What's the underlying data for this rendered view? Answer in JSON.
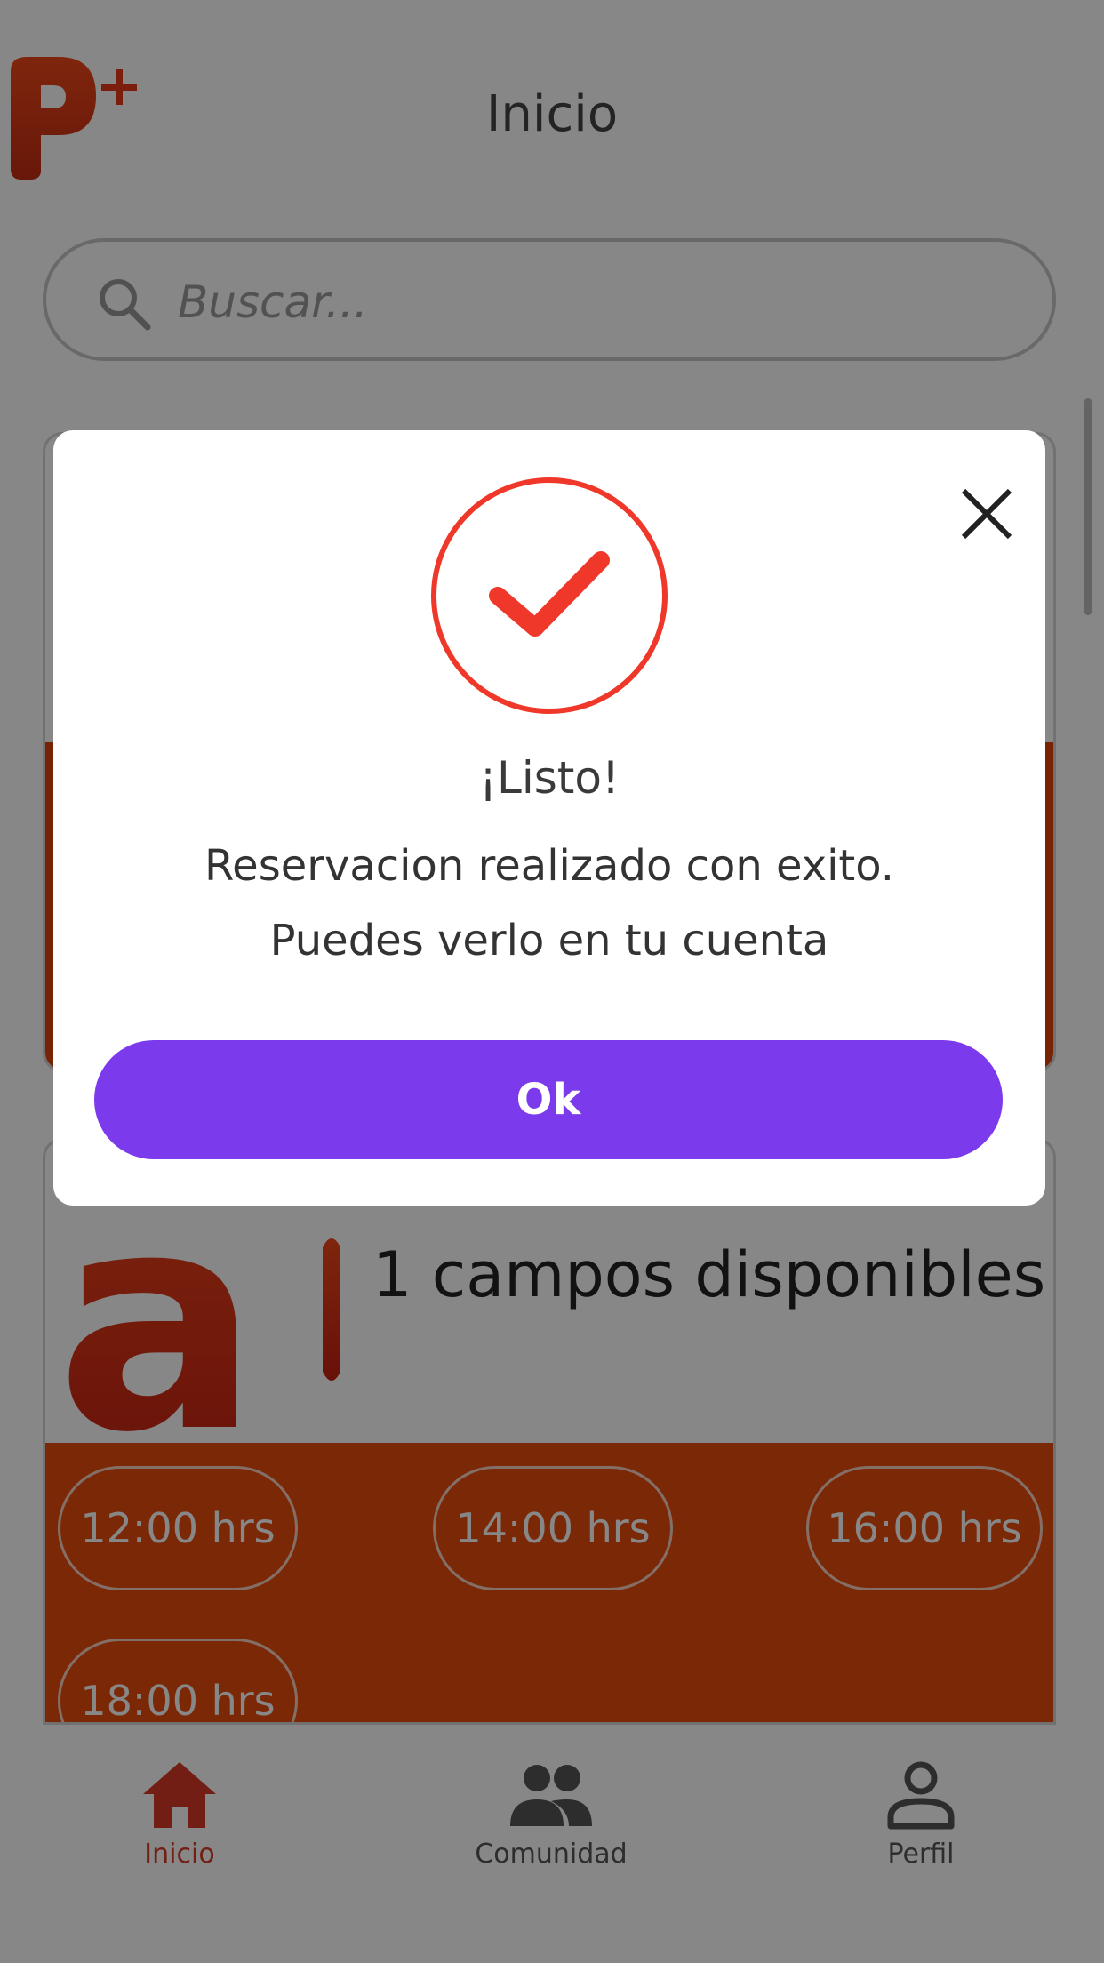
{
  "header": {
    "title": "Inicio",
    "logo_plus": "+"
  },
  "search": {
    "placeholder": "Buscar..."
  },
  "card": {
    "logo_letters": "a",
    "available_fields": "1 campos disponibles",
    "time_slots": [
      "12:00 hrs",
      "14:00 hrs",
      "16:00 hrs",
      "18:00 hrs"
    ]
  },
  "modal": {
    "heading": "¡Listo!",
    "message_line1": "Reservacion realizado con exito.",
    "message_line2": "Puedes verlo en tu cuenta",
    "ok_label": "Ok"
  },
  "nav": {
    "items": [
      {
        "label": "Inicio",
        "icon": "home-icon",
        "active": true
      },
      {
        "label": "Comunidad",
        "icon": "people-icon",
        "active": false
      },
      {
        "label": "Perfil",
        "icon": "person-icon",
        "active": false
      }
    ]
  },
  "colors": {
    "brand_orange": "#e84d0f",
    "accent_red": "#f0382a",
    "button_purple": "#7c3aed",
    "active_nav": "#d93a26"
  }
}
